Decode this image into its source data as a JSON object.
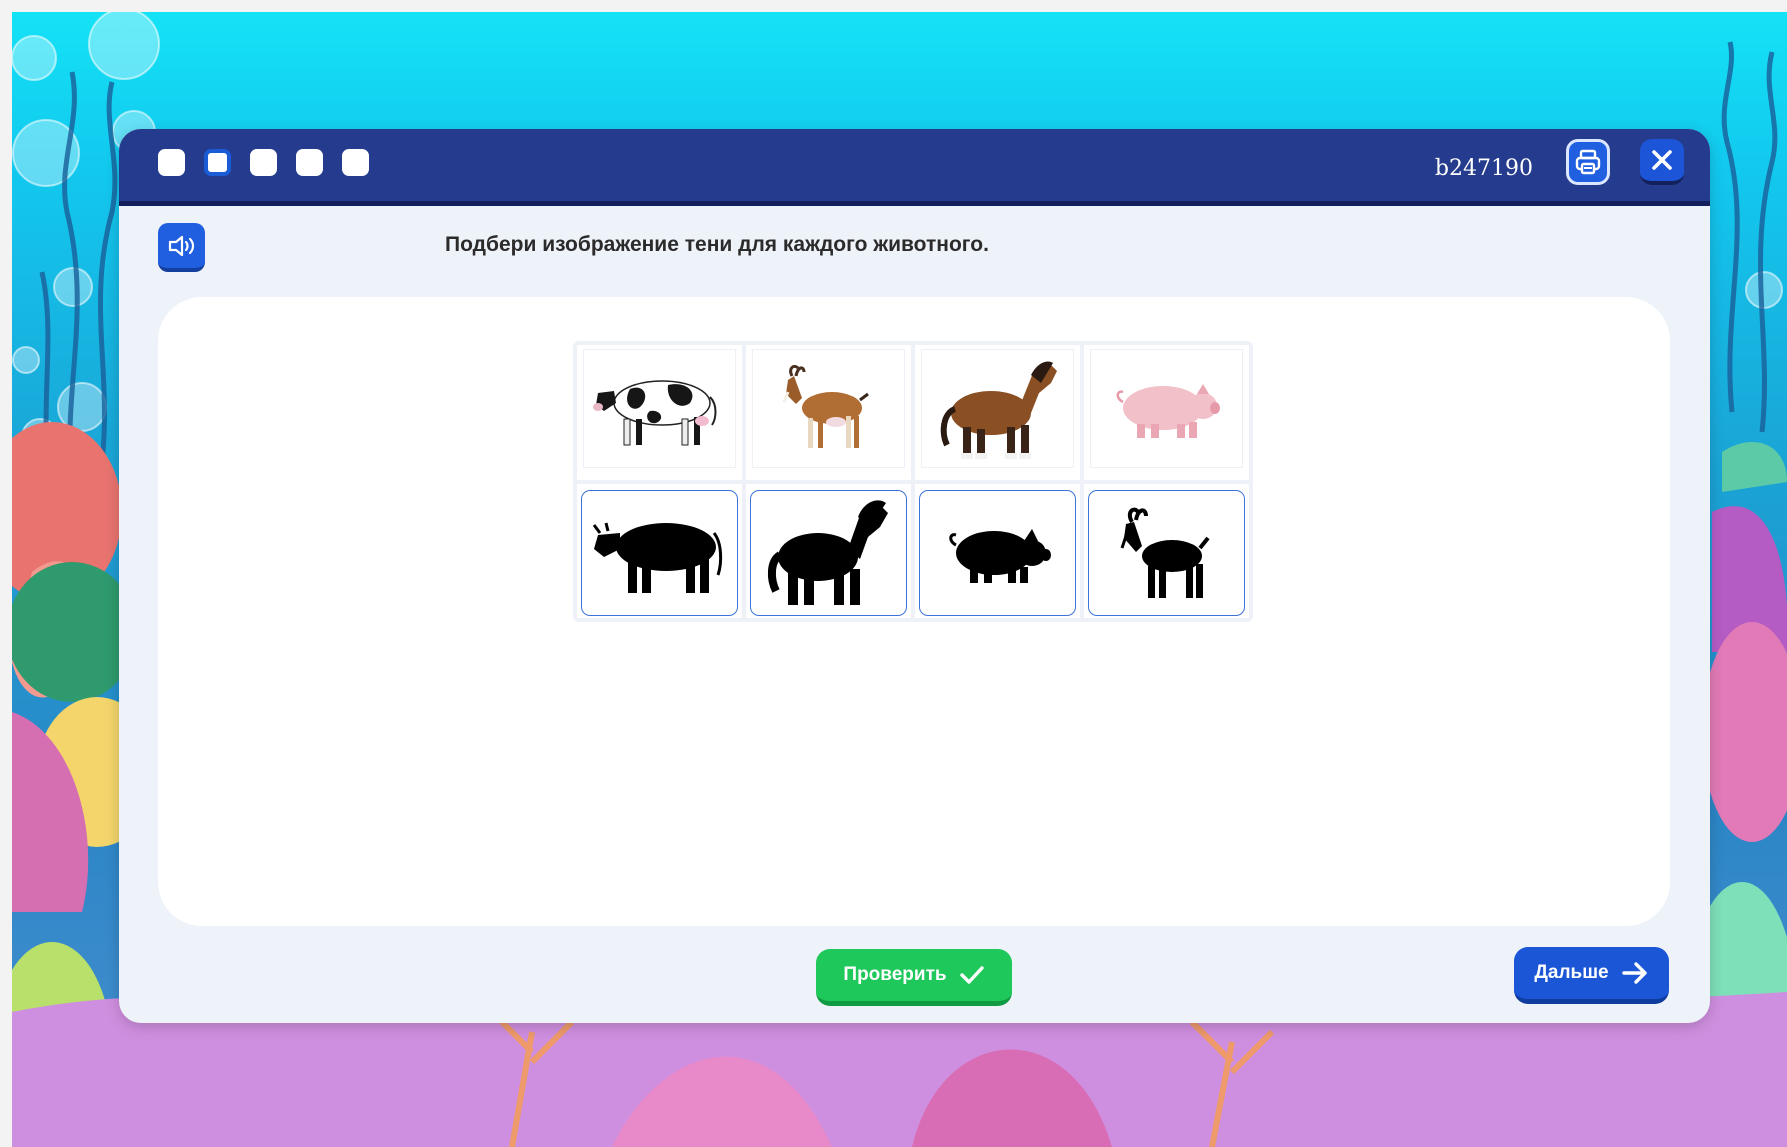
{
  "header": {
    "steps": [
      {
        "name": "step-1",
        "current": false
      },
      {
        "name": "step-2",
        "current": true
      },
      {
        "name": "step-3",
        "current": false
      },
      {
        "name": "step-4",
        "current": false
      },
      {
        "name": "step-5",
        "current": false
      }
    ],
    "task_id": "b247190",
    "print_icon": "printer-icon",
    "close_icon": "close-icon"
  },
  "task": {
    "audio_icon": "speaker-icon",
    "instruction": "Подбери изображение тени для каждого животного."
  },
  "animals": [
    {
      "name": "cow",
      "icon": "cow-photo"
    },
    {
      "name": "goat",
      "icon": "goat-photo"
    },
    {
      "name": "horse",
      "icon": "horse-photo"
    },
    {
      "name": "pig",
      "icon": "pig-photo"
    }
  ],
  "shadows": [
    {
      "name": "cow",
      "icon": "cow-silhouette"
    },
    {
      "name": "horse",
      "icon": "horse-silhouette"
    },
    {
      "name": "pig",
      "icon": "pig-silhouette"
    },
    {
      "name": "goat",
      "icon": "goat-silhouette"
    }
  ],
  "footer": {
    "check_label": "Проверить",
    "next_label": "Дальше"
  },
  "colors": {
    "topbar": "#253b8d",
    "accent_blue": "#1f5fe0",
    "check_green": "#1ec85a",
    "shadow_border": "#3d73d8"
  }
}
